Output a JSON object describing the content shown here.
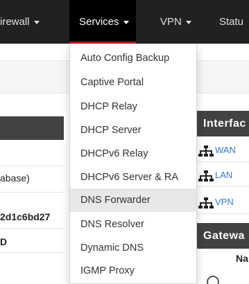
{
  "navbar": {
    "items": [
      {
        "label": "irewall",
        "has_caret": true
      },
      {
        "label": "Services",
        "has_caret": true,
        "active": true
      },
      {
        "label": "VPN",
        "has_caret": true
      },
      {
        "label": "Statu",
        "has_caret": false
      }
    ],
    "accent_color": "#b71c1c"
  },
  "services_menu": {
    "items": [
      "Auto Config Backup",
      "Captive Portal",
      "DHCP Relay",
      "DHCP Server",
      "DHCPv6 Relay",
      "DHCPv6 Server & RA",
      "DNS Forwarder",
      "DNS Resolver",
      "Dynamic DNS",
      "IGMP Proxy"
    ],
    "highlighted": "DNS Forwarder"
  },
  "left_panel": {
    "database_text": "abase)",
    "hash_text": "2d1c6bd27",
    "d_text": "D"
  },
  "interfaces_panel": {
    "title": "Interfac",
    "items": [
      "WAN",
      "LAN",
      "VPN"
    ],
    "icon": "network-icon"
  },
  "gateways_panel": {
    "title": "Gatewa",
    "column_header": "Na"
  }
}
